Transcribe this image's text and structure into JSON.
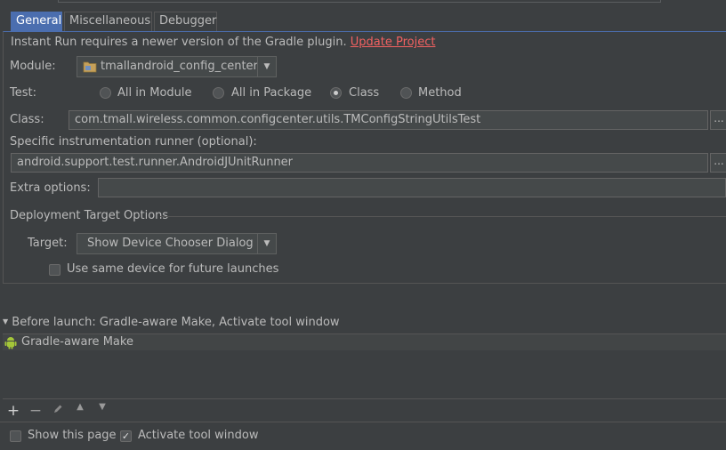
{
  "tabs": [
    {
      "label": "General"
    },
    {
      "label": "Miscellaneous"
    },
    {
      "label": "Debugger"
    }
  ],
  "notice": {
    "text": "Instant Run requires a newer version of the Gradle plugin.",
    "link": "Update Project"
  },
  "module": {
    "label": "Module:",
    "value": "tmallandroid_config_center"
  },
  "test": {
    "label": "Test:",
    "options": [
      {
        "label": "All in Module",
        "checked": false
      },
      {
        "label": "All in Package",
        "checked": false
      },
      {
        "label": "Class",
        "checked": true
      },
      {
        "label": "Method",
        "checked": false
      }
    ]
  },
  "class_field": {
    "label": "Class:",
    "value": "com.tmall.wireless.common.configcenter.utils.TMConfigStringUtilsTest"
  },
  "runner": {
    "label": "Specific instrumentation runner (optional):",
    "value": "android.support.test.runner.AndroidJUnitRunner"
  },
  "extra_options": {
    "label": "Extra options:",
    "value": ""
  },
  "deployment": {
    "section_title": "Deployment Target Options",
    "target_label": "Target:",
    "target_value": "Show Device Chooser Dialog",
    "same_device_label": "Use same device for future launches",
    "same_device_checked": false
  },
  "before_launch": {
    "title": "Before launch: Gradle-aware Make, Activate tool window",
    "items": [
      {
        "label": "Gradle-aware Make",
        "icon": "android-icon"
      }
    ],
    "toolbar": [
      "add-icon",
      "remove-icon",
      "edit-icon",
      "move-up-icon",
      "move-down-icon"
    ]
  },
  "footer": {
    "show_page_label": "Show this page",
    "show_page_checked": false,
    "activate_label": "Activate tool window",
    "activate_checked": true
  },
  "colors": {
    "accent": "#4b6eaf",
    "link": "#f26161",
    "android": "#a4c639"
  }
}
